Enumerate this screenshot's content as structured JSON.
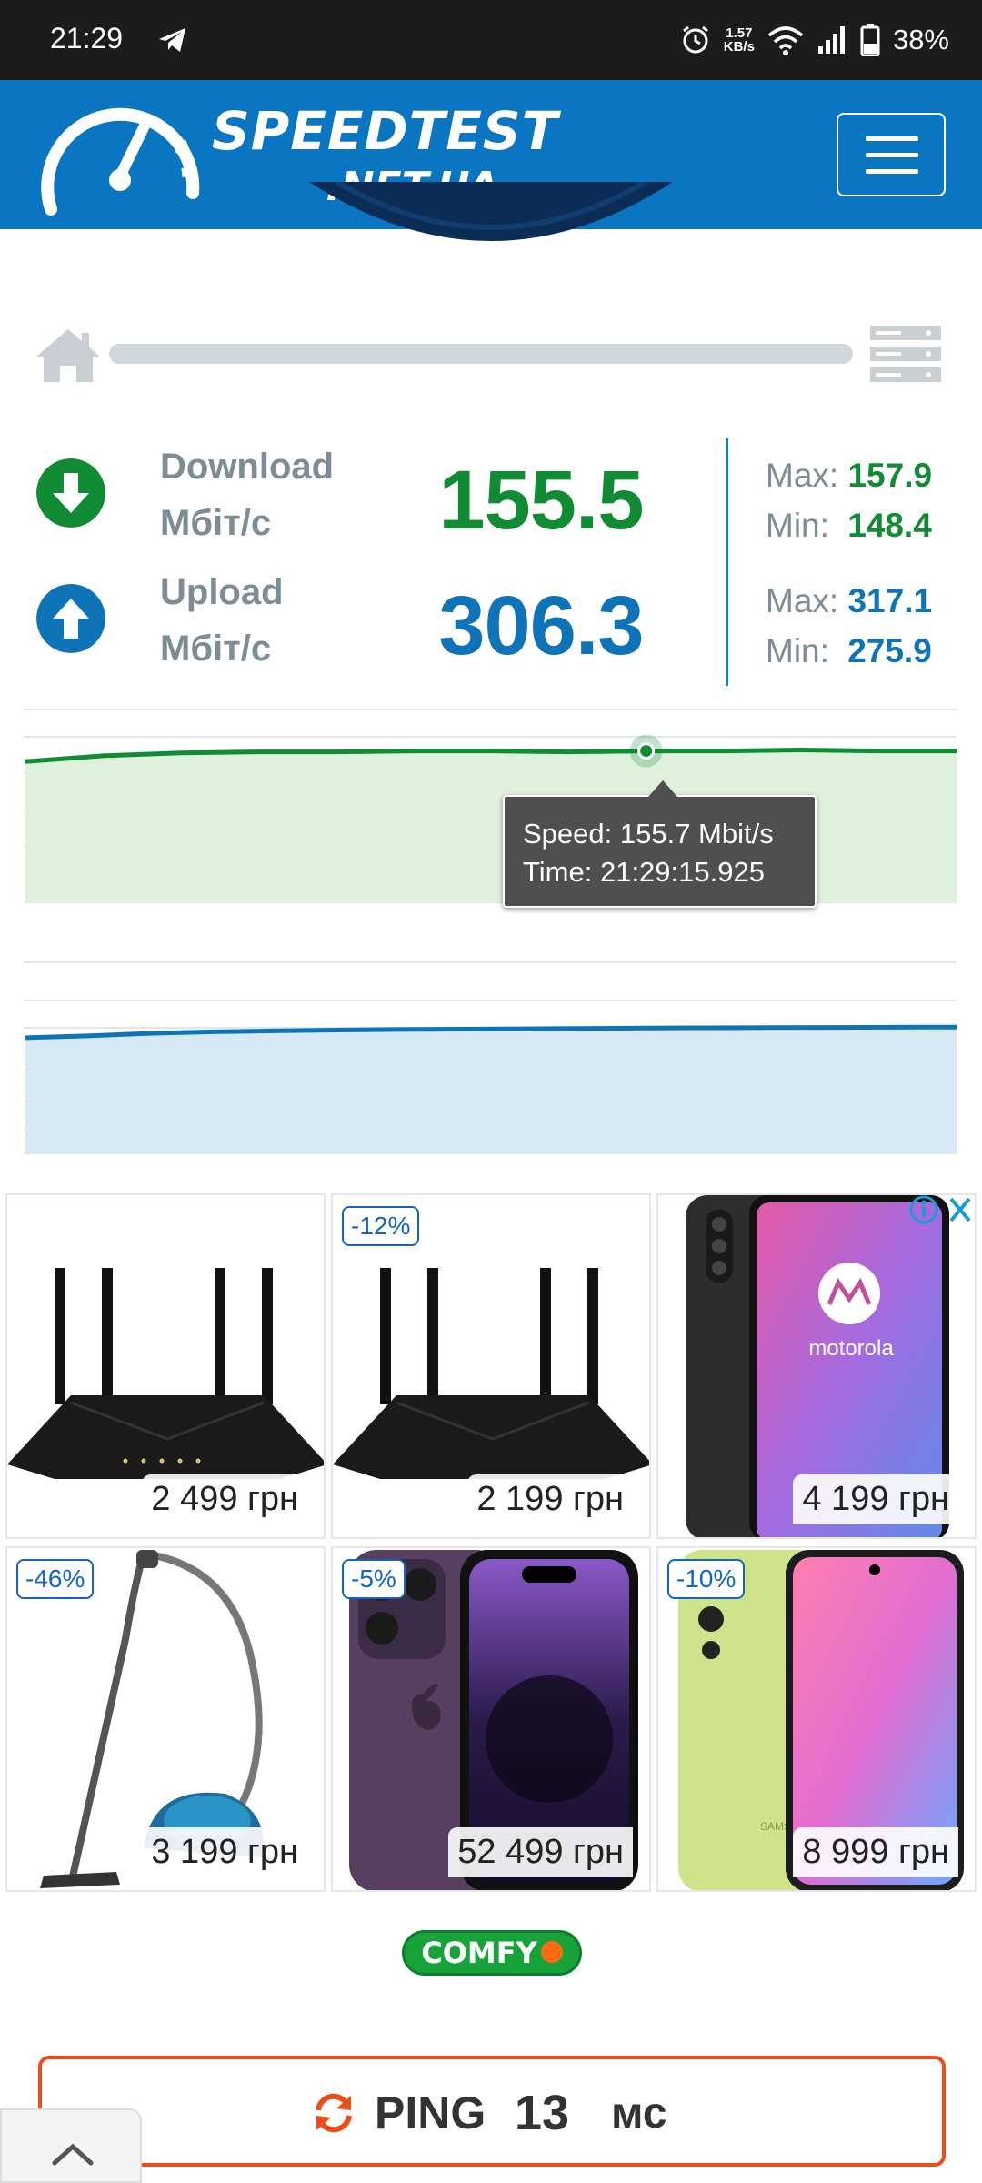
{
  "status_bar": {
    "time": "21:29",
    "net_speed_value": "1.57",
    "net_speed_unit": "KB/s",
    "battery": "38%",
    "icons": [
      "telegram-icon",
      "alarm-icon",
      "wifi-icon",
      "signal-icon",
      "battery-icon"
    ]
  },
  "header": {
    "logo_title": "SPEEDTEST",
    "logo_subtitle": ".NET.UA",
    "brand_color": "#0a76c2"
  },
  "results": {
    "download": {
      "label_line1": "Download",
      "label_line2": "Мбіт/с",
      "value": "155.5",
      "max_label": "Max:",
      "max_value": "157.9",
      "min_label": "Min:",
      "min_value": "148.4",
      "color": "#118b34"
    },
    "upload": {
      "label_line1": "Upload",
      "label_line2": "Мбіт/с",
      "value": "306.3",
      "max_label": "Max:",
      "max_value": "317.1",
      "min_label": "Min:",
      "min_value": "275.9",
      "color": "#0e73b7"
    }
  },
  "chart_data": [
    {
      "type": "area",
      "series": [
        {
          "values": [
            154.6,
            155.2,
            155.5,
            155.6,
            155.6,
            155.7,
            155.7,
            155.6,
            155.7,
            155.7,
            155.8,
            155.7,
            155.7
          ]
        }
      ],
      "ylim": [
        140,
        160
      ],
      "grid": true,
      "tooltip": {
        "speed": "Speed: 155.7 Mbit/s",
        "time": "Time: 21:29:15.925",
        "point_index": 8
      },
      "color": "#118b34",
      "fill": "#dff0dc"
    },
    {
      "type": "area",
      "series": [
        {
          "values": [
            300.5,
            301.5,
            302.8,
            303.6,
            304.1,
            304.5,
            304.8,
            305.0,
            305.2,
            305.4,
            305.6,
            305.7,
            305.8,
            305.9,
            306.0,
            306.1
          ]
        }
      ],
      "ylim": [
        240,
        340
      ],
      "grid": true,
      "color": "#0e73b7",
      "fill": "#d7e9f5"
    }
  ],
  "ads": [
    {
      "price": "2 499 грн",
      "discount": "",
      "image": "router-icon"
    },
    {
      "price": "2 199 грн",
      "discount": "-12%",
      "image": "router-icon"
    },
    {
      "price": "4 199 грн",
      "discount": "",
      "image": "phone-motorola-icon",
      "phone_brand": "motorola"
    },
    {
      "price": "3 199 грн",
      "discount": "-46%",
      "image": "vacuum-icon"
    },
    {
      "price": "52 499 грн",
      "discount": "-5%",
      "image": "phone-iphone-icon"
    },
    {
      "price": "8 999 грн",
      "discount": "-10%",
      "image": "phone-samsung-icon",
      "phone_brand": "SAMSUNG"
    }
  ],
  "ad_brand": "COMFY",
  "ping": {
    "label": "PING",
    "value": "13",
    "unit": "мс",
    "color": "#e94e1b"
  }
}
